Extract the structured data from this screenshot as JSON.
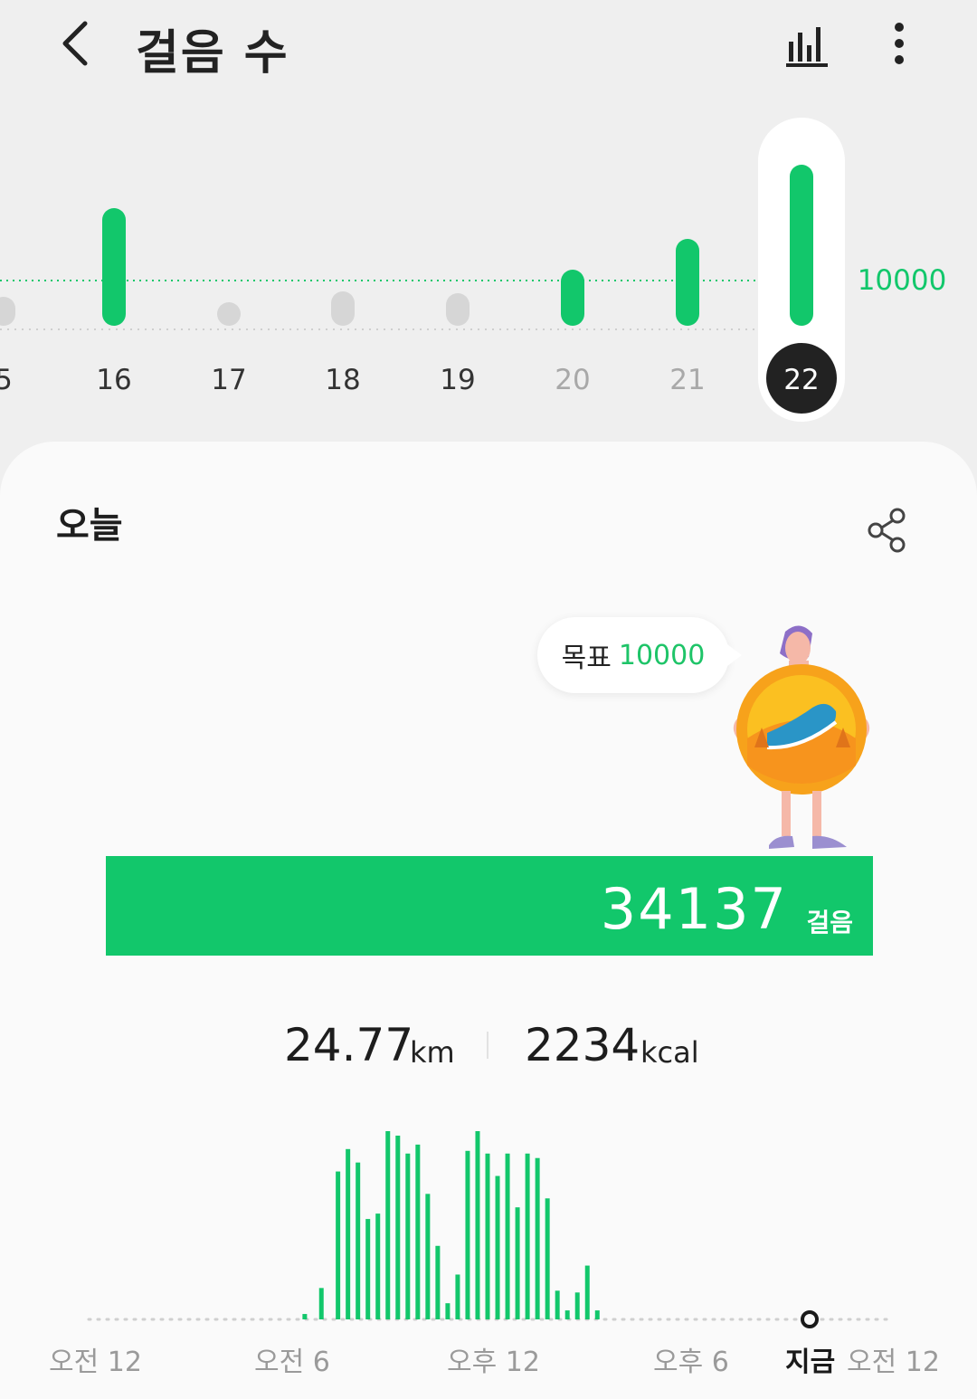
{
  "header": {
    "title": "걸음 수",
    "back_icon": "chevron-left-icon",
    "chart_icon": "bar-chart-icon",
    "more_icon": "more-vertical-icon"
  },
  "daily": {
    "goal_label": "10000",
    "days": [
      {
        "day": "5",
        "reached": false,
        "selected": false,
        "muted": false
      },
      {
        "day": "16",
        "reached": true,
        "selected": false,
        "muted": false
      },
      {
        "day": "17",
        "reached": false,
        "selected": false,
        "muted": false
      },
      {
        "day": "18",
        "reached": false,
        "selected": false,
        "muted": false
      },
      {
        "day": "19",
        "reached": false,
        "selected": false,
        "muted": false
      },
      {
        "day": "20",
        "reached": true,
        "selected": false,
        "muted": true
      },
      {
        "day": "21",
        "reached": true,
        "selected": false,
        "muted": true
      },
      {
        "day": "22",
        "reached": true,
        "selected": true,
        "muted": false
      }
    ]
  },
  "today": {
    "title": "오늘",
    "share_icon": "share-icon",
    "goal_label": "목표",
    "goal_value": "10000",
    "steps": "34137",
    "steps_unit": "걸음",
    "distance": "24.77",
    "distance_unit": "km",
    "calories": "2234",
    "calories_unit": "kcal"
  },
  "hourly_axis": {
    "labels": [
      "오전 12",
      "오전 6",
      "오후 12",
      "오후 6"
    ],
    "now_label": "지금",
    "end_label": "오전 12"
  },
  "colors": {
    "accent": "#12c76b",
    "bar_inactive": "#d6d6d6",
    "text_muted": "#9a9a9a",
    "selected_bg": "#222222"
  },
  "chart_data": {
    "type": "bar",
    "title": "",
    "xlabel": "",
    "ylabel": "",
    "x": [
      6.5,
      7.0,
      7.5,
      7.8,
      8.1,
      8.4,
      8.7,
      9.0,
      9.3,
      9.6,
      9.9,
      10.2,
      10.5,
      10.8,
      11.1,
      11.4,
      11.7,
      12.0,
      12.3,
      12.6,
      12.9,
      13.2,
      13.5,
      13.8,
      14.1,
      14.4,
      14.7,
      15.0,
      15.3,
      15.6,
      15.9,
      16.2,
      16.5
    ],
    "values": [
      6,
      35,
      165,
      190,
      175,
      112,
      118,
      210,
      205,
      185,
      195,
      140,
      82,
      18,
      50,
      188,
      210,
      185,
      160,
      185,
      125,
      185,
      180,
      135,
      32,
      10,
      30,
      60,
      10,
      0,
      0,
      0,
      0
    ],
    "xlim": [
      0,
      24
    ],
    "ylim": [
      0,
      210
    ]
  }
}
